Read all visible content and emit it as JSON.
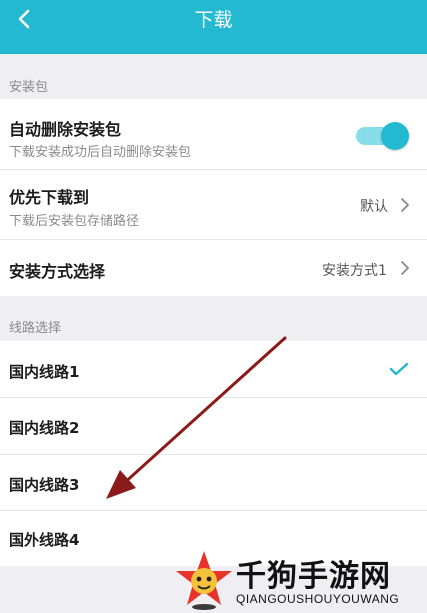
{
  "header": {
    "title": "下载"
  },
  "install_section": {
    "label": "安装包",
    "auto_delete": {
      "title": "自动删除安装包",
      "subtitle": "下载安装成功后自动删除安装包",
      "enabled": true
    },
    "download_to": {
      "title": "优先下载到",
      "subtitle": "下载后安装包存储路径",
      "value": "默认"
    },
    "install_method": {
      "title": "安装方式选择",
      "value": "安装方式1"
    }
  },
  "route_section": {
    "label": "线路选择",
    "routes": [
      {
        "label": "国内线路1",
        "selected": true
      },
      {
        "label": "国内线路2",
        "selected": false
      },
      {
        "label": "国内线路3",
        "selected": false
      },
      {
        "label": "国外线路4",
        "selected": false
      }
    ]
  },
  "watermark": {
    "brand": "千狗手游网",
    "pinyin": "QIANGOUSHOUYOUWANG"
  },
  "colors": {
    "accent": "#22b9d1",
    "toggle_track": "#87dde9",
    "arrow": "#8b1a1a"
  }
}
